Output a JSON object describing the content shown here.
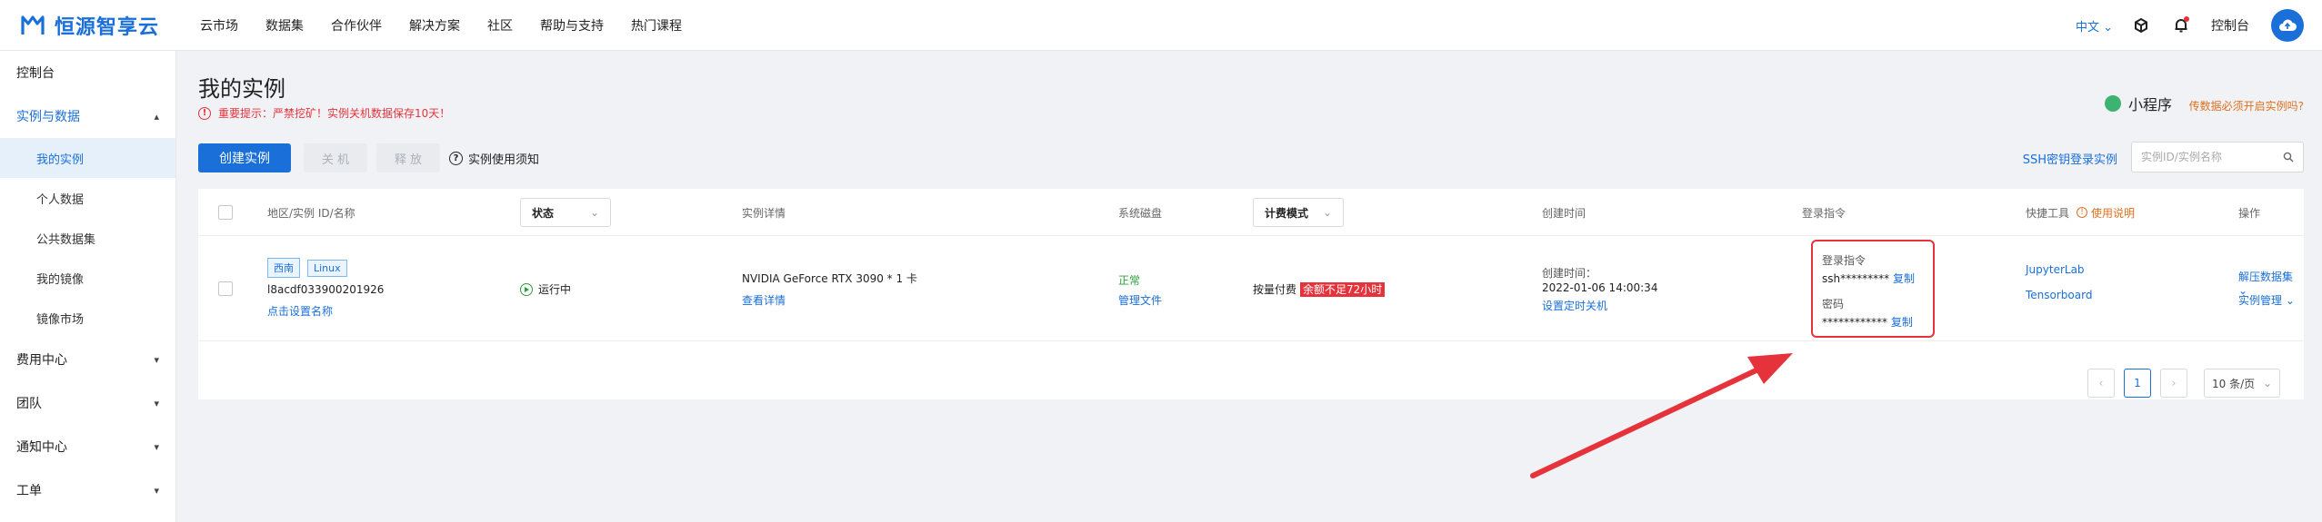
{
  "brand": {
    "name": "恒源智享云"
  },
  "nav": [
    "云市场",
    "数据集",
    "合作伙伴",
    "解决方案",
    "社区",
    "帮助与支持",
    "热门课程"
  ],
  "topright": {
    "lang": "中文",
    "console": "控制台"
  },
  "sidebar": {
    "console": "控制台",
    "group_instances": "实例与数据",
    "sub": [
      "我的实例",
      "个人数据",
      "公共数据集",
      "我的镜像",
      "镜像市场"
    ],
    "groups": [
      "费用中心",
      "团队",
      "通知中心",
      "工单"
    ]
  },
  "page": {
    "title": "我的实例",
    "warning": "重要提示：严禁挖矿！实例关机数据保存10天！",
    "mini_program": "小程序",
    "mini_tip": "传数据必须开启实例吗?"
  },
  "toolbar": {
    "create": "创建实例",
    "shutdown": "关 机",
    "release": "释 放",
    "notice": "实例使用须知",
    "ssh": "SSH密钥登录实例",
    "search_placeholder": "实例ID/实例名称"
  },
  "table": {
    "headers": {
      "region": "地区/实例 ID/名称",
      "status": "状态",
      "detail": "实例详情",
      "disk": "系统磁盘",
      "billing": "计费模式",
      "created": "创建时间",
      "login": "登录指令",
      "tools": "快捷工具",
      "tools_help": "使用说明",
      "ops": "操作"
    },
    "row": {
      "region_tag": "西南",
      "os_tag": "Linux",
      "id": "l8acdf033900201926",
      "set_name": "点击设置名称",
      "status": "运行中",
      "gpu": "NVIDIA GeForce RTX 3090 * 1 卡",
      "view_detail": "查看详情",
      "disk_status": "正常",
      "manage_files": "管理文件",
      "billing": "按量付费",
      "balance_warn": "余额不足72小时",
      "created_label": "创建时间：",
      "created_time": "2022-01-06 14:00:34",
      "auto_shutdown": "设置定时关机",
      "login_label": "登录指令",
      "login_value": "ssh*********",
      "copy": "复制",
      "pwd_label": "密码",
      "pwd_value": "************",
      "tool1": "JupyterLab",
      "tool2": "Tensorboard",
      "op1": "解压数据集",
      "op2": "实例管理"
    }
  },
  "pagination": {
    "current": "1",
    "page_size": "10 条/页"
  },
  "colors": {
    "accent": "#1a6fd8",
    "danger": "#e5323b",
    "success": "#2e9d3a"
  }
}
